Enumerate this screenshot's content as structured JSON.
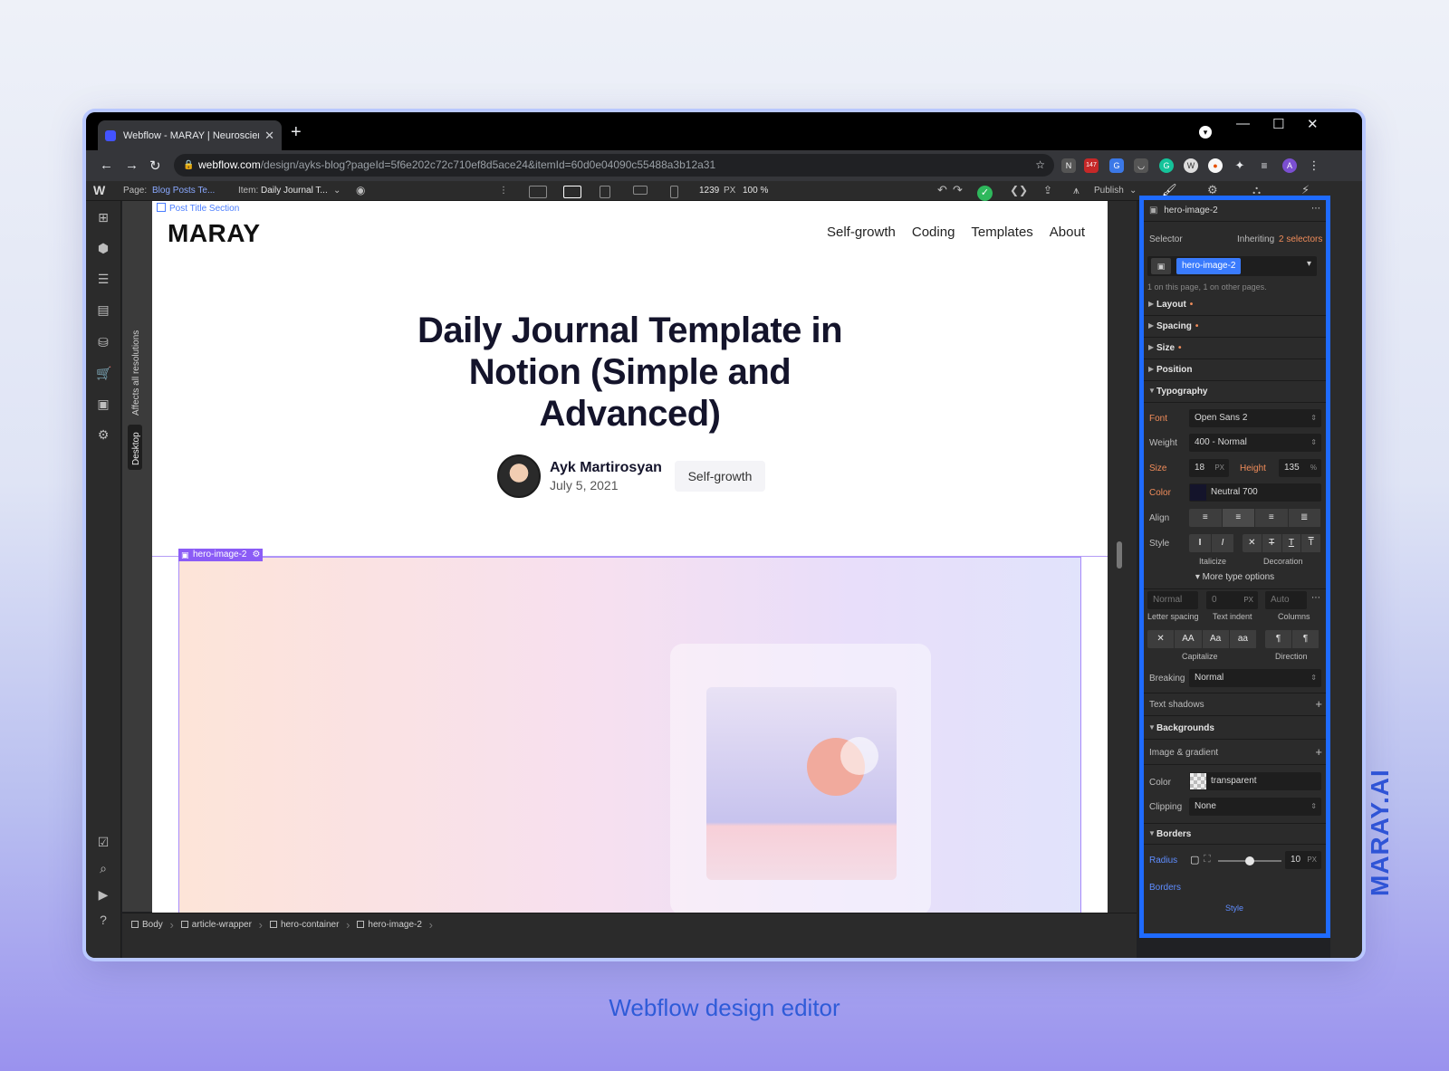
{
  "browser": {
    "tab_title": "Webflow - MARAY | Neuroscienc",
    "tab_close": "✕",
    "new_tab": "+",
    "url_host": "webflow.com",
    "url_path": "/design/ayks-blog?pageId=5f6e202c72c710ef8d5ace24&itemId=60d0e04090c55488a3b12a31",
    "ext_badge": "147",
    "profile_initial": "A",
    "window_min": "—",
    "window_max": "☐",
    "window_close": "✕"
  },
  "webflow_bar": {
    "logo": "W",
    "page_label": "Page:",
    "page_value": "Blog Posts Te...",
    "item_label": "Item:",
    "item_value": "Daily Journal T...",
    "width_readout": "1239",
    "width_unit": "PX",
    "zoom_readout": "100 %",
    "publish_label": "Publish"
  },
  "canvas": {
    "affects_label": "Affects all resolutions",
    "desktop_label": "Desktop",
    "section_label": "Post Title Section",
    "brand": "MARAY",
    "nav": [
      "Self-growth",
      "Coding",
      "Templates",
      "About"
    ],
    "post_title": "Daily Journal Template in Notion (Simple and Advanced)",
    "author_name": "Ayk Martirosyan",
    "post_date": "July 5, 2021",
    "category_tag": "Self-growth",
    "hero_badge": "hero-image-2"
  },
  "breadcrumbs": [
    "Body",
    "article-wrapper",
    "hero-container",
    "hero-image-2"
  ],
  "style_panel": {
    "element_name": "hero-image-2",
    "selector_label": "Selector",
    "inheriting_label": "Inheriting",
    "inheriting_count": "2 selectors",
    "selector_chip": "hero-image-2",
    "usage_note": "1 on this page, 1 on other pages.",
    "sections": {
      "layout": "Layout",
      "spacing": "Spacing",
      "size": "Size",
      "position": "Position",
      "typography": "Typography",
      "backgrounds": "Backgrounds",
      "borders": "Borders"
    },
    "typography": {
      "font_label": "Font",
      "font_value": "Open Sans 2",
      "weight_label": "Weight",
      "weight_value": "400 - Normal",
      "size_label": "Size",
      "size_value": "18",
      "size_unit": "PX",
      "height_label": "Height",
      "height_value": "135",
      "height_unit": "%",
      "color_label": "Color",
      "color_value": "Neutral 700",
      "align_label": "Align",
      "style_label": "Style",
      "italicize_label": "Italicize",
      "decoration_label": "Decoration",
      "more_options": "More type options",
      "letter_spacing_value": "Normal",
      "text_indent_value": "0",
      "text_indent_unit": "PX",
      "columns_value": "Auto",
      "letter_spacing_label": "Letter spacing",
      "text_indent_label": "Text indent",
      "columns_label": "Columns",
      "capitalize_label": "Capitalize",
      "direction_label": "Direction",
      "breaking_label": "Breaking",
      "breaking_value": "Normal",
      "text_shadows_label": "Text shadows"
    },
    "backgrounds": {
      "image_gradient_label": "Image & gradient",
      "color_label": "Color",
      "color_value": "transparent",
      "clipping_label": "Clipping",
      "clipping_value": "None"
    },
    "borders": {
      "radius_label": "Radius",
      "radius_value": "10",
      "radius_unit": "PX",
      "borders_label": "Borders",
      "style_label": "Style"
    }
  },
  "side_brand": "MARAY.AI",
  "caption": "Webflow design editor",
  "colors": {
    "accent_blue": "#1f6bff",
    "selection_purple": "#8b5cf6",
    "publish_green": "#2eb85c",
    "label_orange": "#f08c5a"
  }
}
